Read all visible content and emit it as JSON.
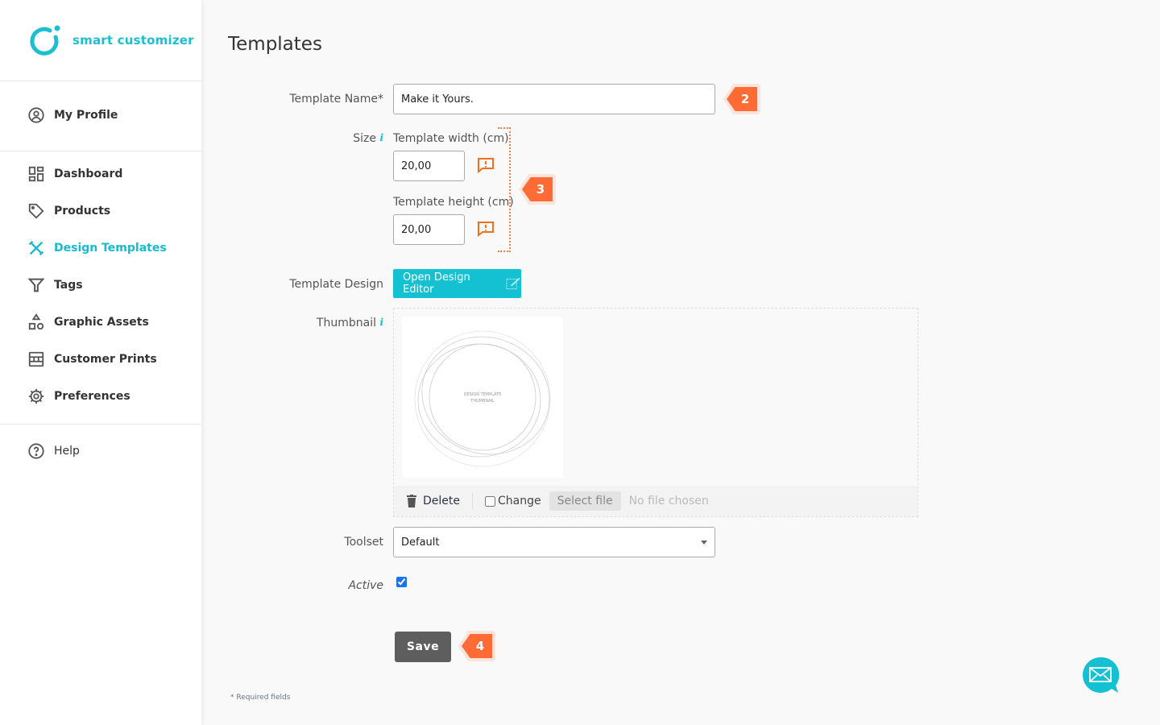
{
  "brand": {
    "name": "smart customizer",
    "color": "#1cbfd0"
  },
  "sidebar": {
    "items": [
      {
        "label": "My Profile",
        "icon": "user-circle-icon"
      },
      {
        "label": "Dashboard",
        "icon": "dashboard-icon"
      },
      {
        "label": "Products",
        "icon": "tag-icon"
      },
      {
        "label": "Design Templates",
        "icon": "design-tools-icon",
        "active": true
      },
      {
        "label": "Tags",
        "icon": "filter-icon"
      },
      {
        "label": "Graphic Assets",
        "icon": "shapes-icon"
      },
      {
        "label": "Customer Prints",
        "icon": "prints-icon"
      },
      {
        "label": "Preferences",
        "icon": "gear-icon"
      },
      {
        "label": "Help",
        "icon": "help-circle-icon"
      }
    ]
  },
  "page": {
    "title": "Templates"
  },
  "form": {
    "name_label": "Template Name*",
    "name_value": "Make it Yours.",
    "size_label": "Size",
    "info_glyph": "i",
    "width_label": "Template width (cm)",
    "width_value": "20,00",
    "height_label": "Template height (cm)",
    "height_value": "20,00",
    "design_label": "Template Design",
    "design_button": "Open Design Editor",
    "thumb_label": "Thumbnail",
    "thumb_text1": "DESIGN TEMPLATE",
    "thumb_text2": "THUMBNAIL",
    "delete_label": "Delete",
    "change_label": "Change",
    "select_file": "Select file",
    "no_file": "No file chosen",
    "toolset_label": "Toolset",
    "toolset_value": "Default",
    "active_label": "Active",
    "active_checked": true,
    "save_label": "Save",
    "required_note": "* Required fields"
  },
  "badges": [
    "2",
    "3",
    "4"
  ],
  "colors": {
    "accent": "#14c1d3",
    "badge": "#ff6b35",
    "save": "#5e5e5e"
  }
}
